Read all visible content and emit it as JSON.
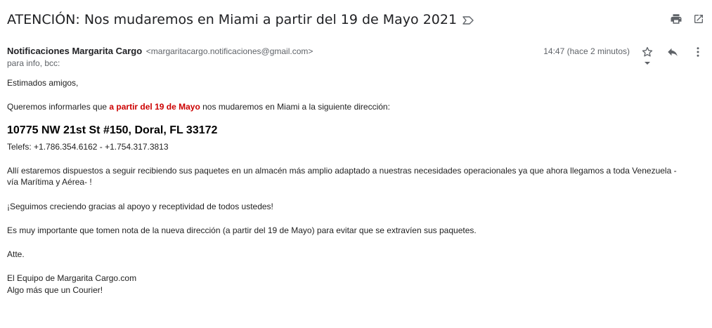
{
  "email": {
    "subject": "ATENCIÓN: Nos mudaremos en Miami a partir del 19 de Mayo 2021",
    "sender_name": "Notificaciones Margarita Cargo",
    "sender_email": "<margaritacargo.notificaciones@gmail.com>",
    "recipients": "para info, bcc:",
    "time": "14:47 (hace 2 minutos)"
  },
  "icons": {
    "label": "label-arrow-icon",
    "print": "print-icon",
    "open_new": "open-in-new-window-icon",
    "star": "star-icon",
    "reply": "reply-icon",
    "more": "more-vertical-icon",
    "caret": "chevron-down-icon"
  },
  "body": {
    "greeting": "Estimados amigos,",
    "intro_before": "Queremos informarles que ",
    "intro_highlight": "a partir del 19 de Mayo",
    "intro_after": " nos mudaremos en Miami a la siguiente dirección:",
    "address": "10775 NW 21st St #150, Doral, FL 33172",
    "phones": "Telefs: +1.786.354.6162 - +1.754.317.3813",
    "main": "Allí estaremos dispuestos a seguir recibiendo sus paquetes en un almacén más amplio adaptado a nuestras necesidades operacionales ya que ahora llegamos a toda Venezuela -vía Marítima y Aérea- !",
    "thanks": "¡Seguimos creciendo gracias al apoyo y receptividad de todos ustedes!",
    "note": "Es muy importante que tomen nota de la nueva dirección (a partir del 19 de Mayo) para evitar que se extravíen sus paquetes.",
    "closing": "Atte.",
    "signature_line1": "El Equipo de Margarita Cargo.com",
    "signature_line2": "Algo más que un Courier!"
  },
  "colors": {
    "highlight": "#cc0000",
    "icon": "#5f6368"
  }
}
